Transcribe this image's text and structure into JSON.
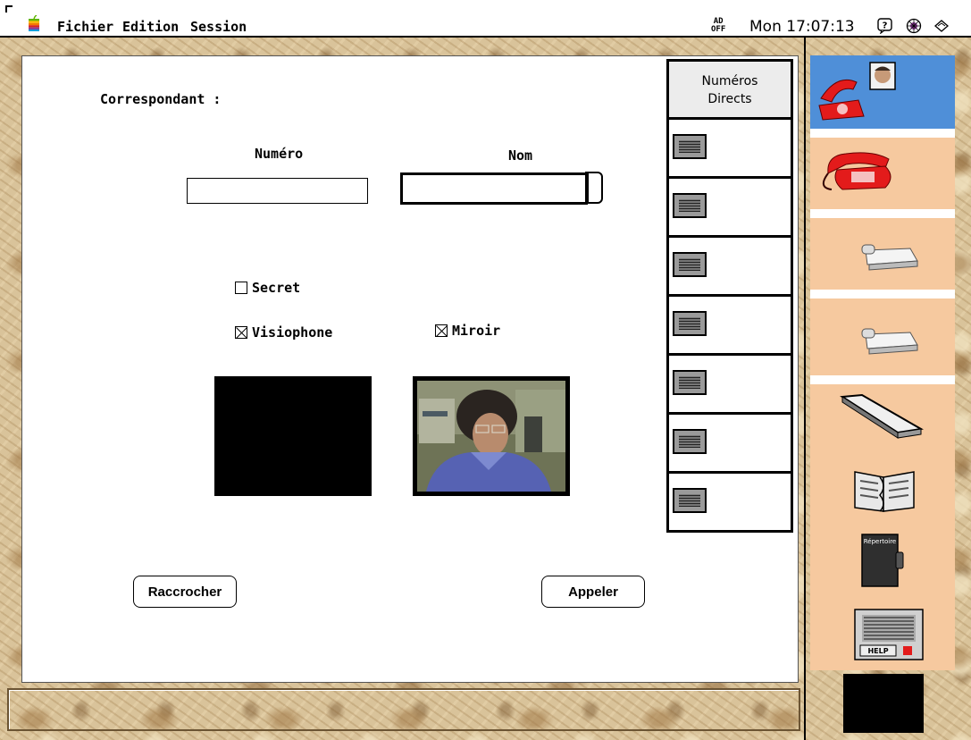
{
  "menubar": {
    "menus": [
      "Fichier",
      "Edition",
      "Session"
    ],
    "ad_off_line1": "AD",
    "ad_off_line2": "OFF",
    "clock": "Mon 17:07:13"
  },
  "icons": {
    "apple": "apple-icon",
    "help_balloon": "help-icon",
    "control_strip": "control-icon",
    "app_switch": "app-icon"
  },
  "form": {
    "correspondant_label": "Correspondant :",
    "numero_label": "Numéro",
    "nom_label": "Nom",
    "numero_value": "",
    "nom_value": "",
    "secret_label": "Secret",
    "secret_checked": false,
    "visiophone_label": "Visiophone",
    "visiophone_checked": true,
    "miroir_label": "Miroir",
    "miroir_checked": true
  },
  "buttons": {
    "hangup": "Raccrocher",
    "call": "Appeler"
  },
  "speed_dial": {
    "header_line1": "Numéros",
    "header_line2": "Directs",
    "slots": [
      "",
      "",
      "",
      "",
      "",
      "",
      ""
    ]
  },
  "tools": [
    "videophone",
    "telephone",
    "fax",
    "fax-2",
    "tray",
    "directory-book",
    "repertoire",
    "help-panel"
  ],
  "colors": {
    "active_tool": "#4f8fd8",
    "tool_bg": "#f6c99f",
    "marble": "#d9c39a"
  },
  "tool_labels": {
    "repertoire": "Répertoire",
    "help": "HELP"
  }
}
